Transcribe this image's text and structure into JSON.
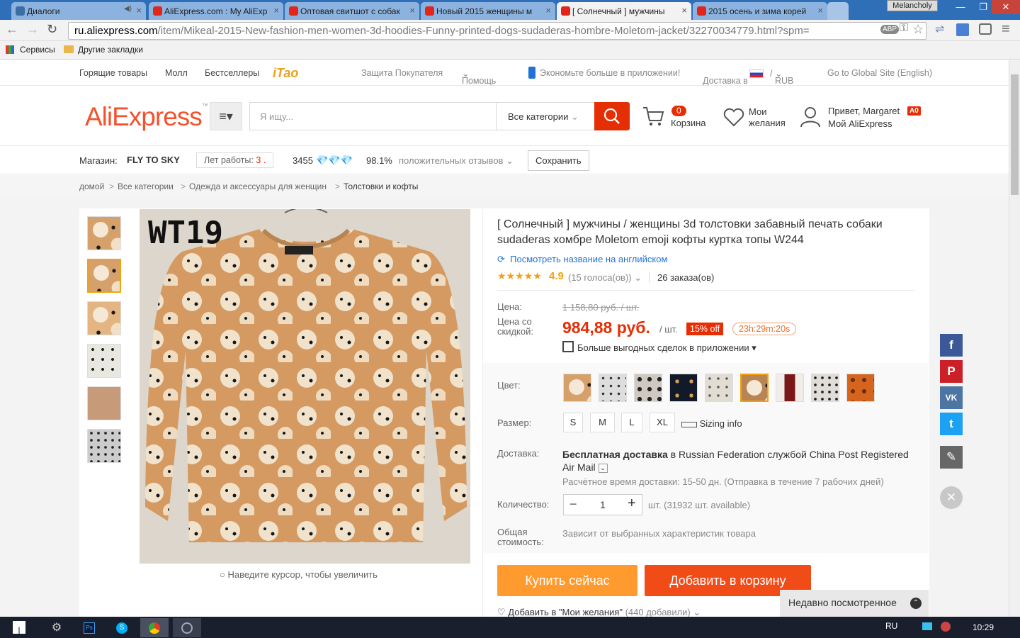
{
  "browser": {
    "tabs": [
      {
        "label": "Диалоги",
        "icon": "vk"
      },
      {
        "label": "AliExpress.com : My AliExp",
        "icon": "aliexpress"
      },
      {
        "label": "Оптовая свитшот с собак",
        "icon": "aliexpress"
      },
      {
        "label": "Новый 2015 женщины м",
        "icon": "aliexpress"
      },
      {
        "label": "[ Солнечный ] мужчины",
        "icon": "aliexpress"
      },
      {
        "label": "2015 осень и зима корей",
        "icon": "aliexpress"
      }
    ],
    "profile": "Melancholy",
    "url_domain": "ru.aliexpress.com",
    "url_path": "/item/Mikeal-2015-New-fashion-men-women-3d-hoodies-Funny-printed-dogs-sudaderas-hombre-Moletom-jacket/32270034779.html?spm=",
    "bookmarks": [
      "Сервисы",
      "Другие закладки"
    ]
  },
  "topnav": {
    "hot": "Горящие товары",
    "mall": "Молл",
    "best": "Бестселлеры",
    "itao": "iTao",
    "protect": "Защита Покупателя",
    "help": "Помощь",
    "app": "Экономьте больше в приложении!",
    "delivery": "Доставка в",
    "currency": "RUB",
    "global": "Go to Global Site (English)"
  },
  "header": {
    "logo": "AliExpress",
    "search_placeholder": "Я ищу...",
    "category": "Все категории",
    "cart_count": "0",
    "cart": "Корзина",
    "wish1": "Мои",
    "wish2": "желания",
    "greet": "Привет, Margaret",
    "badge": "A0",
    "my": "Мой AliExpress"
  },
  "store": {
    "label": "Магазин:",
    "name": "FLY TO SKY",
    "years_label": "Лет работы:",
    "years": "3 .",
    "score": "3455",
    "positive": "98.1%",
    "positive_label": "положительных отзывов",
    "save": "Сохранить"
  },
  "breadcrumb": [
    "домой",
    "Все категории",
    "Одежда и аксессуары для женщин",
    "Толстовки и кофты"
  ],
  "product": {
    "image_label": "WT19",
    "zoom_hint": "Наведите курсор, чтобы увеличить",
    "title": "[ Солнечный ] мужчины / женщины 3d толстовки забавный печать собаки sudaderas хомбре Moletom emoji кофты куртка топы W244",
    "translate": "Посмотреть название на английском",
    "rating": "4.9",
    "votes": "(15 голоса(ов))",
    "orders": "26 заказа(ов)",
    "price_label": "Цена:",
    "old_price": "1 158,80 руб. / шт.",
    "discount_label": "Цена со скидкой:",
    "price": "984,88 руб.",
    "per": "/ шт.",
    "off": "15% off",
    "timer": "23h:29m:20s",
    "app_deals": "Больше выгодных сделок в приложении",
    "color_label": "Цвет:",
    "size_label": "Размер:",
    "sizes": [
      "S",
      "M",
      "L",
      "XL"
    ],
    "sizing": "Sizing info",
    "ship_label": "Доставка:",
    "ship_free": "Бесплатная доставка",
    "ship_in": "в",
    "ship_country": "Russian Federation",
    "ship_by": "службой",
    "ship_carrier": "China Post Registered Air Mail",
    "ship_time": "Расчётное время доставки: 15-50 дн. (Отправка в течение 7 рабочих дней)",
    "qty_label": "Количество:",
    "qty": "1",
    "qty_avail": "шт. (31932 шт. available)",
    "total_label": "Общая стоимость:",
    "total": "Зависит от выбранных характеристик товара",
    "buy": "Купить сейчас",
    "add_cart": "Добавить в корзину",
    "wishlist": "Добавить в \"Мои желания\"",
    "wish_count": "(440 добавили)"
  },
  "recent": "Недавно посмотренное",
  "taskbar": {
    "lang": "RU",
    "time": "10:29"
  }
}
